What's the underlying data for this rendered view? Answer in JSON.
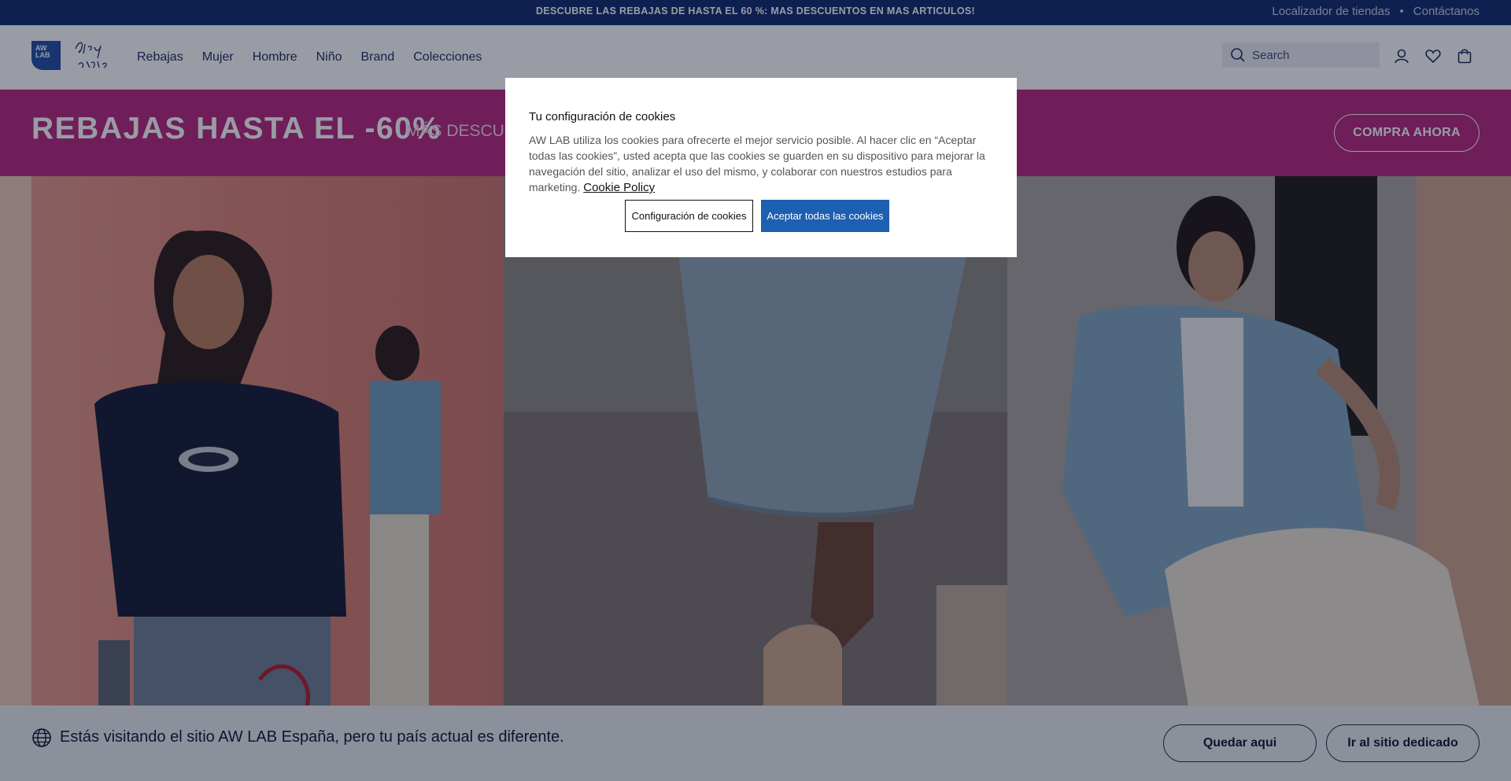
{
  "topbar": {
    "promo": "DESCUBRE LAS REBAJAS DE HASTA EL 60 %: MAS DESCUENTOS EN MAS ARTICULOS!",
    "store_locator": "Localizador de tiendas",
    "separator": "•",
    "contact": "Contáctanos"
  },
  "header": {
    "logo_text_1": "AW",
    "logo_text_2": "LAB",
    "logo_script": "play style",
    "nav": [
      "Rebajas",
      "Mujer",
      "Hombre",
      "Niño",
      "Brand",
      "Colecciones"
    ],
    "search_placeholder": "Search"
  },
  "banner": {
    "headline": "REBAJAS HASTA EL -60%",
    "subline": "MÁS DESCUENT",
    "cta": "COMPRA AHORA",
    "color": "#b5267d"
  },
  "cookies": {
    "title": "Tu configuración de cookies",
    "body": "AW LAB utiliza los cookies para ofrecerte el mejor servicio posible. Al hacer clic en “Aceptar todas las cookies”, usted acepta que las cookies se guarden en su dispositivo para mejorar la navegación del sitio, analizar el uso del mismo, y colaborar con nuestros estudios para marketing.",
    "policy_link": "Cookie Policy",
    "config_button": "Configuración de cookies",
    "accept_button": "Aceptar todas las cookies"
  },
  "country_bar": {
    "message": "Estás visitando el sitio AW LAB España, pero tu país actual es diferente.",
    "stay_button": "Quedar aqui",
    "go_button": "Ir al sitio dedicado"
  },
  "colors": {
    "topbar": "#0e2a6b",
    "accent": "#1d5fb0",
    "brand_blue": "#1f4ea6"
  }
}
